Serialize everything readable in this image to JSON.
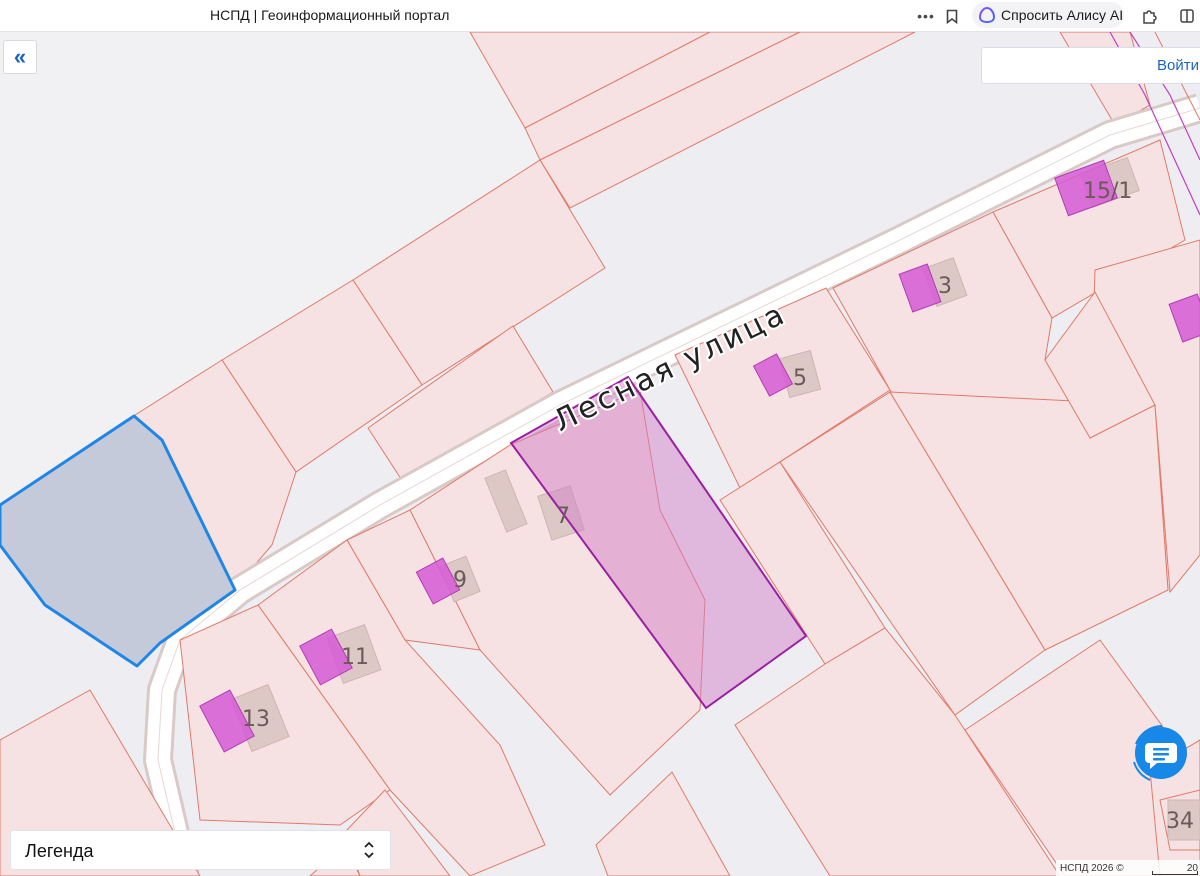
{
  "browser": {
    "tab_title": "НСПД | Геоинформационный портал",
    "more_icon": "more-dots-icon",
    "bookmark_icon": "bookmark-icon",
    "alice_label": "Спросить Алису AI",
    "alice_icon": "alice-icon",
    "extensions_icon": "puzzle-icon"
  },
  "panel": {
    "collapse_icon": "double-chevron-left-icon",
    "collapse_glyph": "«"
  },
  "auth": {
    "login_label": "Войти"
  },
  "map": {
    "street_label": "Лесная улица",
    "parcel_numbers": [
      "15/1",
      "3",
      "5",
      "7",
      "9",
      "11",
      "13",
      "34"
    ],
    "colors": {
      "background": "#eeeef2",
      "parcel_fill": "#f6e2e2",
      "parcel_stroke": "#e07a6a",
      "building_fill": "#d8c7c5",
      "object_fill": "#d65ad6",
      "selected_fill": "#e2b9dd",
      "selected_stroke": "#9b1fa3",
      "highlight_fill": "#c5cada",
      "highlight_stroke": "#1f86e6",
      "road_fill": "#ffffff",
      "road_stroke": "#d9c9c7",
      "boundary_line": "#c040c0"
    }
  },
  "legend": {
    "label": "Легенда",
    "chevron_icon": "chevron-up-down-icon"
  },
  "chat": {
    "icon": "chat-bubble-icon",
    "color": "#1787e8"
  },
  "footer": {
    "attribution": "НСПД 2026 ©",
    "scale": "20"
  }
}
